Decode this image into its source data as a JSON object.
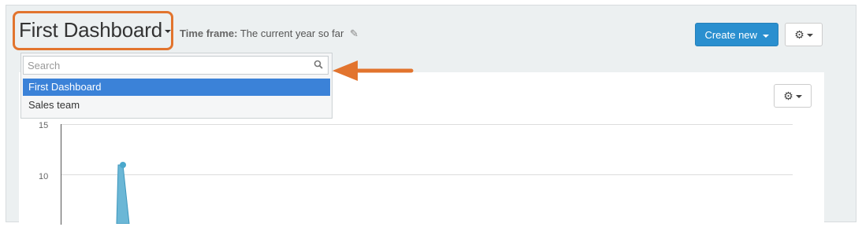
{
  "header": {
    "dashboard_title": "First Dashboard",
    "timeframe_label": "Time frame:",
    "timeframe_value": "The current year so far",
    "create_new_label": "Create new"
  },
  "dropdown": {
    "search_placeholder": "Search",
    "items": [
      {
        "label": "First Dashboard",
        "selected": true
      },
      {
        "label": "Sales team",
        "selected": false
      }
    ]
  },
  "chart_data": {
    "type": "line",
    "yticks": [
      "15",
      "10"
    ],
    "ylim": [
      5,
      15
    ],
    "points": [
      {
        "x": 1,
        "y": 11
      }
    ],
    "series_color": "#4aa8cc"
  },
  "colors": {
    "accent": "#2a8fcf",
    "highlight": "#e2742e",
    "selected_item": "#3b82d8"
  }
}
